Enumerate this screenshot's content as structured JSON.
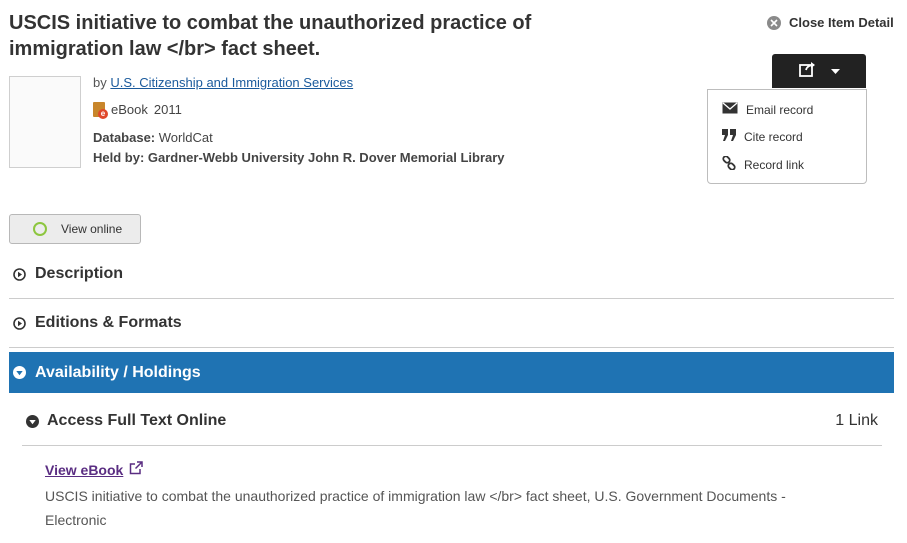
{
  "item": {
    "title": "USCIS initiative to combat the unauthorized practice of immigration law </br> fact sheet.",
    "by_prefix": "by",
    "author": "U.S. Citizenship and Immigration Services",
    "format": "eBook",
    "year": "2011",
    "database_label": "Database:",
    "database_value": "WorldCat",
    "held_by": "Held by: Gardner-Webb University John R. Dover Memorial Library"
  },
  "header": {
    "close_label": "Close Item Detail"
  },
  "share_menu": {
    "items": [
      {
        "label": "Email record",
        "icon": "envelope-icon"
      },
      {
        "label": "Cite record",
        "icon": "quote-icon"
      },
      {
        "label": "Record link",
        "icon": "link-icon"
      }
    ]
  },
  "buttons": {
    "view_online": "View online"
  },
  "sections": {
    "description": "Description",
    "editions": "Editions & Formats",
    "availability": "Availability / Holdings"
  },
  "access": {
    "title": "Access Full Text Online",
    "count": "1 Link",
    "link_label": "View eBook",
    "link_description": "USCIS initiative to combat the unauthorized practice of immigration law </br> fact sheet, U.S. Government Documents - Electronic"
  },
  "colors": {
    "accent": "#1f73b3",
    "ring": "#8dc63f",
    "visited_link": "#5a2d82"
  }
}
